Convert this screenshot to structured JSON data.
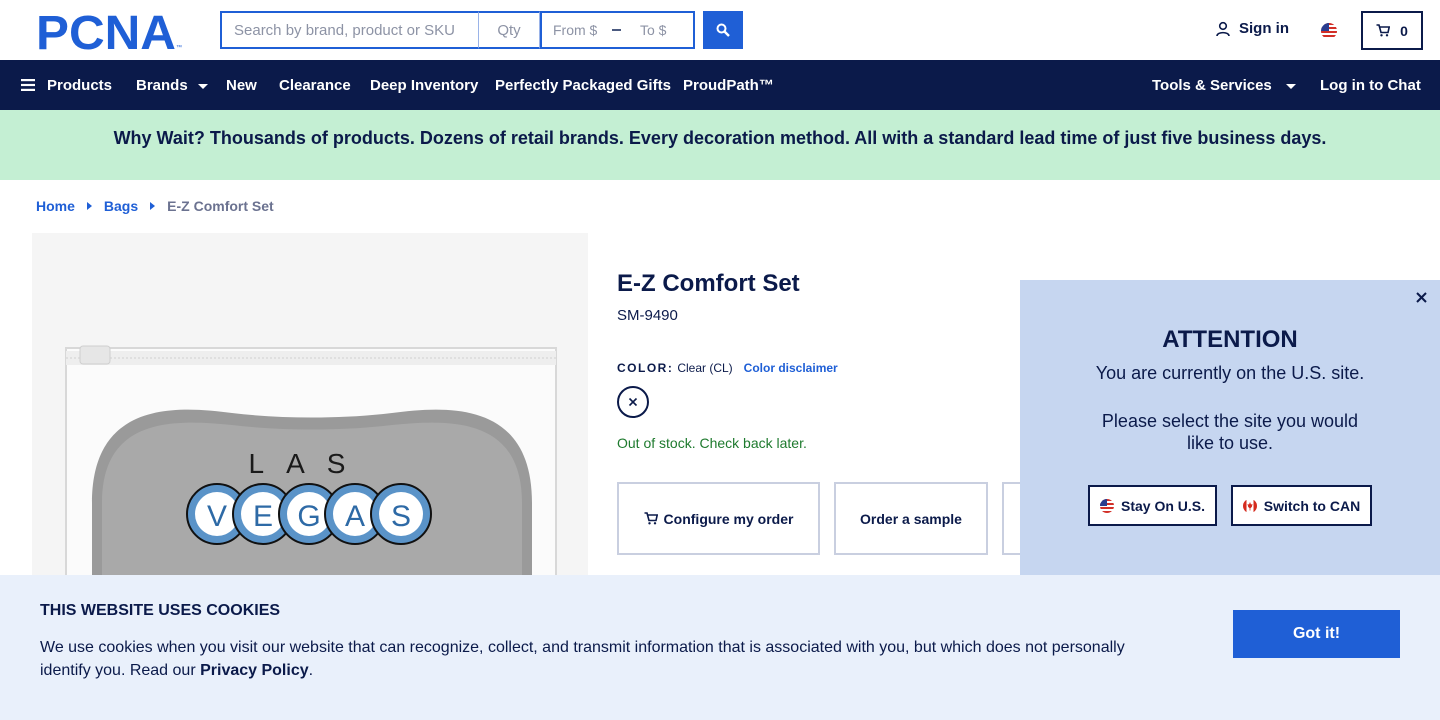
{
  "header": {
    "logo_text": "PCNA",
    "search_placeholder": "Search by brand, product or SKU",
    "qty_placeholder": "Qty",
    "price_from_placeholder": "From $",
    "price_to_placeholder": "To $",
    "search_icon": "search-icon",
    "sign_in_label": "Sign in",
    "cart_count": "0"
  },
  "nav": {
    "products": "Products",
    "brands": "Brands",
    "new": "New",
    "clearance": "Clearance",
    "deep_inventory": "Deep Inventory",
    "gifts": "Perfectly Packaged Gifts",
    "proudpath": "ProudPath™",
    "tools": "Tools & Services",
    "chat": "Log in to Chat"
  },
  "promo": {
    "text": "Why Wait? Thousands of products. Dozens of retail brands. Every decoration method. All with a standard lead time of just five business days."
  },
  "breadcrumb": {
    "home": "Home",
    "bags": "Bags",
    "current": "E-Z Comfort Set"
  },
  "product": {
    "title": "E-Z Comfort Set",
    "sku": "SM-9490",
    "color_label": "COLOR:",
    "color_value": "Clear (CL)",
    "color_disclaimer": "Color disclaimer",
    "stock_status": "Out of stock. Check back later.",
    "configure_label": "Configure my order",
    "sample_label": "Order a sample",
    "image_text_top": "LAS",
    "image_letters": [
      "V",
      "E",
      "G",
      "A",
      "S"
    ]
  },
  "attention": {
    "title": "ATTENTION",
    "current_site": "You are currently on the U.S. site.",
    "select_prompt": "Please select the site you would like to use.",
    "stay_label": "Stay On U.S.",
    "switch_label": "Switch to CAN"
  },
  "cookie": {
    "title": "THIS WEBSITE USES COOKIES",
    "text_before": "We use cookies when you visit our website that can recognize, collect, and transmit information that is associated with you, but which does not personally identify you. Read our ",
    "privacy_link": "Privacy Policy",
    "text_after": ".",
    "got_it": "Got it!"
  },
  "colors": {
    "navy": "#0b1a4a",
    "brand_blue": "#1f5fd6",
    "promo_green": "#c4efd3",
    "popup_blue": "#c6d6f0",
    "cookie_bg": "#e9f0fb",
    "stock_green": "#1e7a2e"
  }
}
